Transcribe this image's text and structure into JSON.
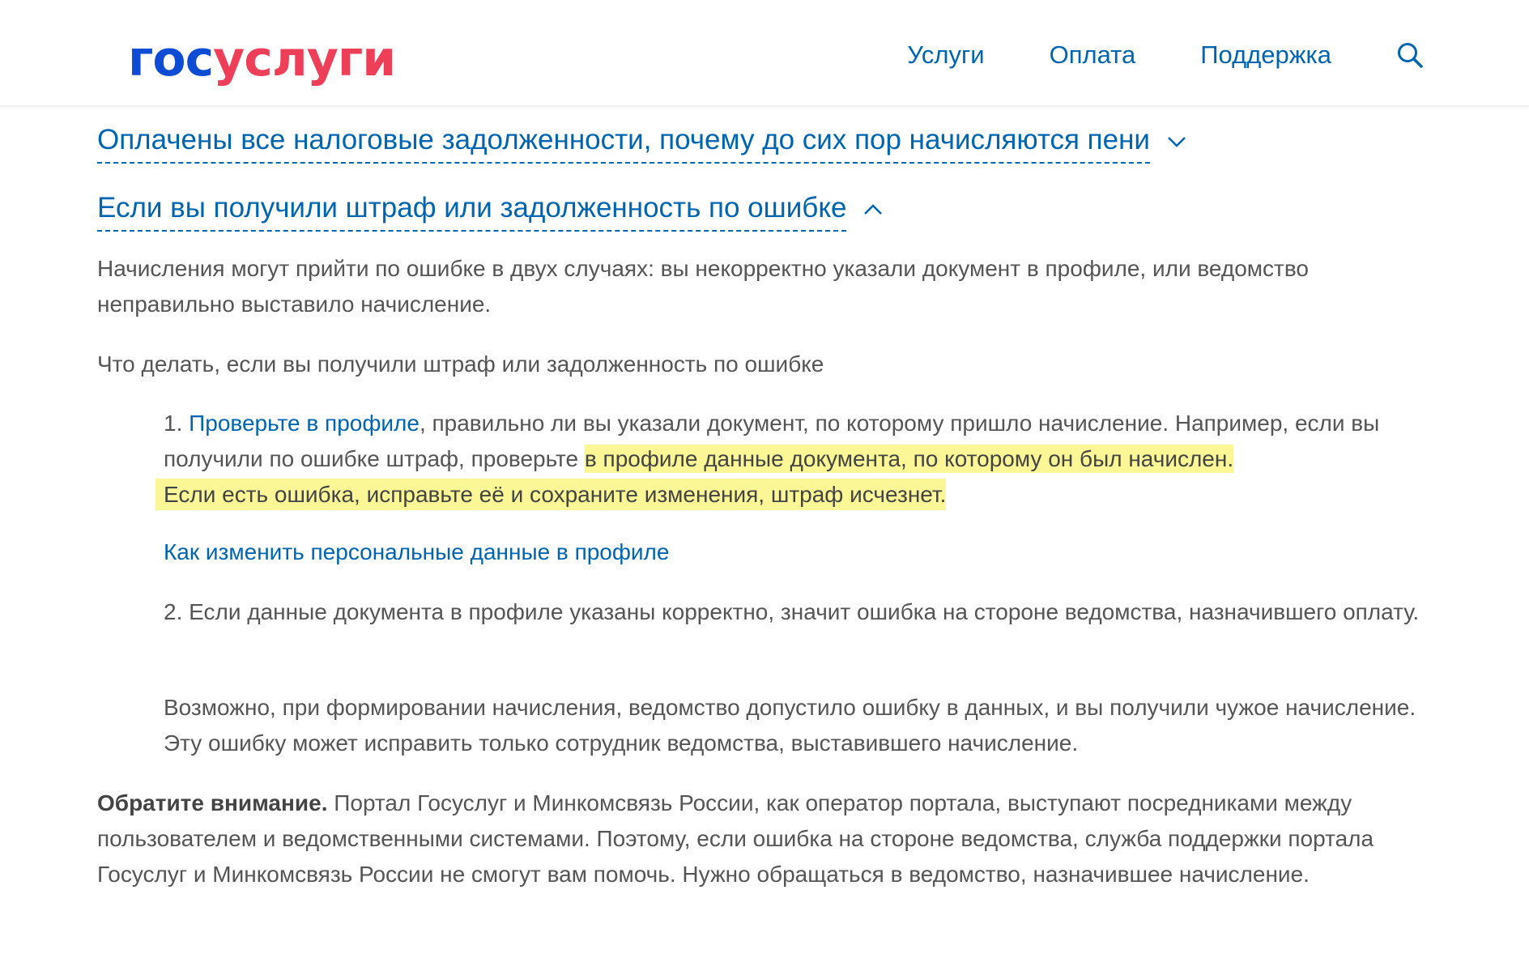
{
  "header": {
    "logo_part1": "гос",
    "logo_part2": "услуги",
    "nav": [
      "Услуги",
      "Оплата",
      "Поддержка"
    ]
  },
  "accordion": {
    "collapsed_title": "Оплачены все налоговые задолженности, почему до сих пор начисляются пени",
    "expanded_title": "Если вы получили штраф или задолженность по ошибке"
  },
  "body": {
    "intro": "Начисления могут прийти по ошибке в двух случаях: вы некорректно указали документ в профиле, или ведомство неправильно выставило начисление.",
    "what_to_do": "Что делать, если вы получили штраф или задолженность по ошибке",
    "step1_number": "1. ",
    "step1_link": "Проверьте в профиле",
    "step1_text": ", правильно ли вы указали документ, по которому пришло начисление. Например, если вы получили по ошибке штраф, проверьте ",
    "step1_highlight_a": "в профиле данные документа, по которому он был начислен.",
    "step1_highlight_b": "Если есть ошибка, исправьте её и сохраните изменения, штраф исчезнет.",
    "change_data_link": "Как изменить персональные данные в профиле",
    "step2_text": "2. Если данные документа в профиле указаны корректно, значит ошибка на стороне ведомства, назначившего оплату.",
    "possible_text": "Возможно, при формировании начисления, ведомство допустило ошибку в данных, и вы получили чужое начисление. Эту ошибку может исправить только сотрудник ведомства, выставившего начисление.",
    "note_bold": "Обратите внимание.",
    "note_text": " Портал Госуслуг и Минкомсвязь России, как оператор портала, выступают посредниками между пользователем и ведомственными системами. Поэтому, если ошибка на стороне ведомства, служба поддержки портала Госуслуг и Минкомсвязь России не смогут вам помочь. Нужно обращаться в ведомство, назначившее начисление."
  },
  "colors": {
    "link": "#0065b1",
    "logo_blue": "#0d4cd3",
    "logo_red": "#ee3f58",
    "highlight": "#fbf696",
    "text": "#555555"
  },
  "icons": {
    "search": "search-icon",
    "collapsed": "chevron-down-icon",
    "expanded": "chevron-up-icon"
  }
}
